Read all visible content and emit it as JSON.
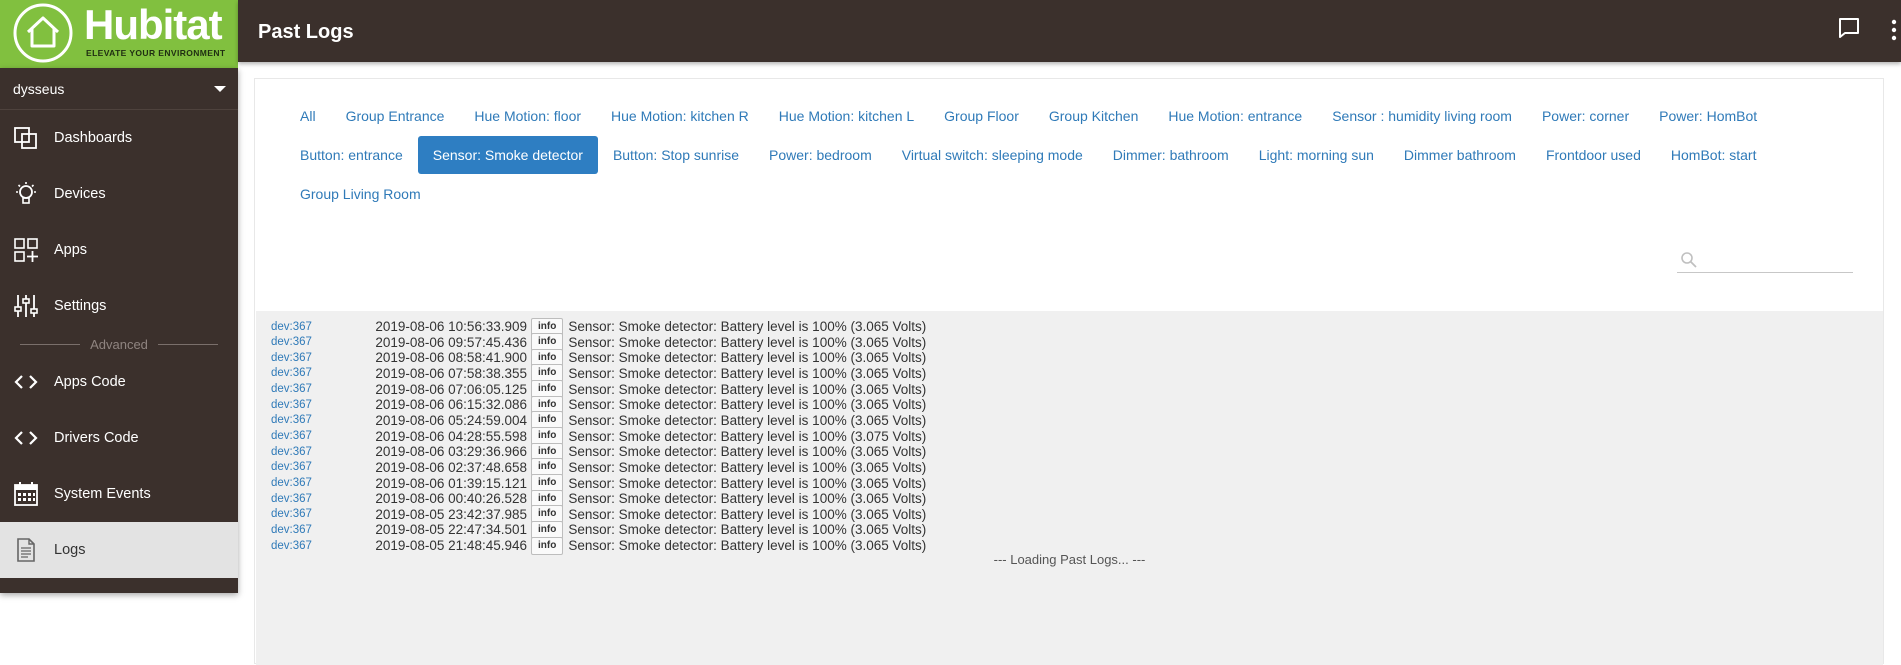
{
  "brand": {
    "name": "Hubitat",
    "tagline": "ELEVATE YOUR ENVIRONMENT",
    "color": "#81c03f"
  },
  "header": {
    "title": "Past Logs"
  },
  "sidebar": {
    "user": "dysseus",
    "items": [
      {
        "label": "Dashboards",
        "icon": "dashboards-icon"
      },
      {
        "label": "Devices",
        "icon": "bulb-icon"
      },
      {
        "label": "Apps",
        "icon": "apps-icon"
      },
      {
        "label": "Settings",
        "icon": "sliders-icon"
      }
    ],
    "advanced_label": "Advanced",
    "advanced_items": [
      {
        "label": "Apps Code",
        "icon": "code-icon"
      },
      {
        "label": "Drivers Code",
        "icon": "code-icon"
      },
      {
        "label": "System Events",
        "icon": "calendar-icon"
      },
      {
        "label": "Logs",
        "icon": "document-icon"
      }
    ]
  },
  "tabs": [
    "All",
    "Group Entrance",
    "Hue Motion: floor",
    "Hue Motion: kitchen R",
    "Hue Motion: kitchen L",
    "Group Floor",
    "Group Kitchen",
    "Hue Motion: entrance",
    "Sensor : humidity living room",
    "Power: corner",
    "Power: HomBot",
    "Button: entrance",
    "Sensor: Smoke detector",
    "Button: Stop sunrise",
    "Power: bedroom",
    "Virtual switch: sleeping mode",
    "Dimmer: bathroom",
    "Light: morning sun",
    "Dimmer bathroom",
    "Frontdoor used",
    "HomBot: start",
    "Group Living Room"
  ],
  "active_tab": "Sensor: Smoke detector",
  "search": {
    "value": "",
    "placeholder": ""
  },
  "logs": [
    {
      "dev": "dev:367",
      "time": "2019-08-06 10:56:33.909",
      "level": "info",
      "msg": "Sensor: Smoke detector: Battery level is 100% (3.065 Volts)"
    },
    {
      "dev": "dev:367",
      "time": "2019-08-06 09:57:45.436",
      "level": "info",
      "msg": "Sensor: Smoke detector: Battery level is 100% (3.065 Volts)"
    },
    {
      "dev": "dev:367",
      "time": "2019-08-06 08:58:41.900",
      "level": "info",
      "msg": "Sensor: Smoke detector: Battery level is 100% (3.065 Volts)"
    },
    {
      "dev": "dev:367",
      "time": "2019-08-06 07:58:38.355",
      "level": "info",
      "msg": "Sensor: Smoke detector: Battery level is 100% (3.065 Volts)"
    },
    {
      "dev": "dev:367",
      "time": "2019-08-06 07:06:05.125",
      "level": "info",
      "msg": "Sensor: Smoke detector: Battery level is 100% (3.065 Volts)"
    },
    {
      "dev": "dev:367",
      "time": "2019-08-06 06:15:32.086",
      "level": "info",
      "msg": "Sensor: Smoke detector: Battery level is 100% (3.065 Volts)"
    },
    {
      "dev": "dev:367",
      "time": "2019-08-06 05:24:59.004",
      "level": "info",
      "msg": "Sensor: Smoke detector: Battery level is 100% (3.065 Volts)"
    },
    {
      "dev": "dev:367",
      "time": "2019-08-06 04:28:55.598",
      "level": "info",
      "msg": "Sensor: Smoke detector: Battery level is 100% (3.075 Volts)"
    },
    {
      "dev": "dev:367",
      "time": "2019-08-06 03:29:36.966",
      "level": "info",
      "msg": "Sensor: Smoke detector: Battery level is 100% (3.065 Volts)"
    },
    {
      "dev": "dev:367",
      "time": "2019-08-06 02:37:48.658",
      "level": "info",
      "msg": "Sensor: Smoke detector: Battery level is 100% (3.065 Volts)"
    },
    {
      "dev": "dev:367",
      "time": "2019-08-06 01:39:15.121",
      "level": "info",
      "msg": "Sensor: Smoke detector: Battery level is 100% (3.065 Volts)"
    },
    {
      "dev": "dev:367",
      "time": "2019-08-06 00:40:26.528",
      "level": "info",
      "msg": "Sensor: Smoke detector: Battery level is 100% (3.065 Volts)"
    },
    {
      "dev": "dev:367",
      "time": "2019-08-05 23:42:37.985",
      "level": "info",
      "msg": "Sensor: Smoke detector: Battery level is 100% (3.065 Volts)"
    },
    {
      "dev": "dev:367",
      "time": "2019-08-05 22:47:34.501",
      "level": "info",
      "msg": "Sensor: Smoke detector: Battery level is 100% (3.065 Volts)"
    },
    {
      "dev": "dev:367",
      "time": "2019-08-05 21:48:45.946",
      "level": "info",
      "msg": "Sensor: Smoke detector: Battery level is 100% (3.065 Volts)"
    }
  ],
  "loading_text": "--- Loading Past Logs... ---"
}
